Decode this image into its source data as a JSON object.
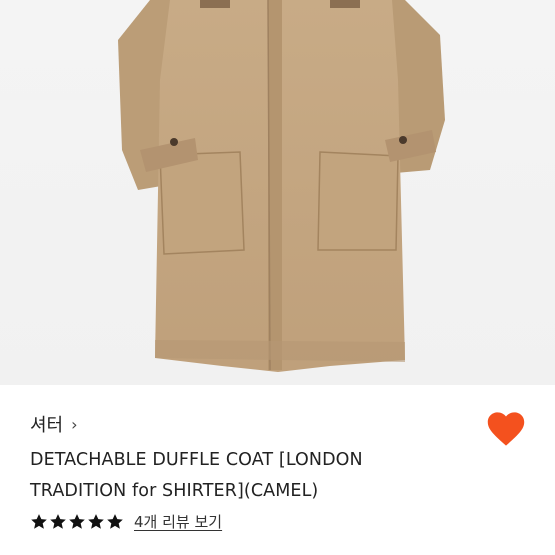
{
  "product": {
    "brand": "셔터",
    "brand_chevron": "chevron-right-icon",
    "title": "DETACHABLE DUFFLE COAT [LONDON TRADITION for SHIRTER](CAMEL)",
    "favorited": true,
    "rating": 5,
    "review_link_label": "4개 리뷰 보기"
  },
  "colors": {
    "heart": "#f4511e",
    "star": "#111111",
    "coat": "#c4a680",
    "image_bg": "#f2f2f2"
  }
}
